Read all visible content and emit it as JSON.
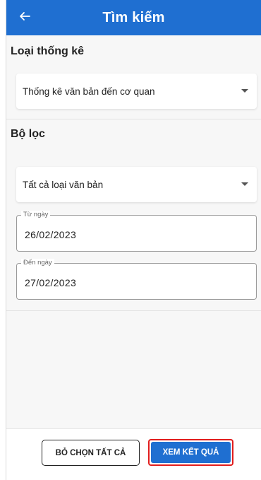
{
  "header": {
    "title": "Tìm kiếm",
    "back_icon": "arrow-left-icon"
  },
  "report_type": {
    "section_title": "Loại thống kê",
    "selected": "Thống kê văn bản đến cơ quan"
  },
  "filter": {
    "section_title": "Bộ lọc",
    "document_type_selected": "Tất cả loại văn bản",
    "from_date": {
      "label": "Từ ngày",
      "value": "26/02/2023"
    },
    "to_date": {
      "label": "Đến ngày",
      "value": "27/02/2023"
    }
  },
  "actions": {
    "clear_all_label": "BỎ CHỌN TẤT CẢ",
    "view_results_label": "XEM KẾT QUẢ"
  },
  "colors": {
    "primary": "#1f6fd1",
    "highlight_border": "#e11d1d",
    "background": "#f7f7f7"
  }
}
